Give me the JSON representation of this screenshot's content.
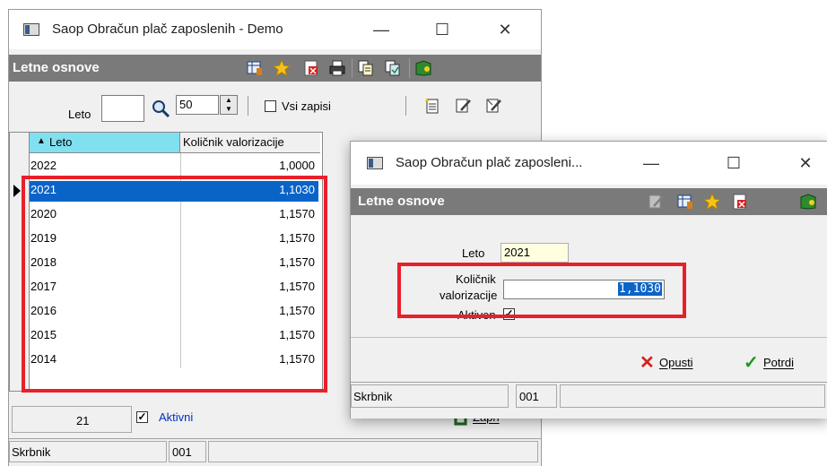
{
  "main_window": {
    "title": "Saop Obračun plač zaposlenih - Demo",
    "controls": {
      "minimize": "—",
      "maximize": "☐",
      "close": "✕"
    },
    "header_title": "Letne osnove",
    "filter": {
      "leto_label": "Leto",
      "leto_value": "",
      "count_value": "50",
      "vsi_zapisi_label": "Vsi zapisi"
    },
    "grid": {
      "sort_indicator": "▲",
      "columns": [
        "Leto",
        "Količnik valorizacije"
      ],
      "rows": [
        {
          "leto": "2022",
          "kolicnik": "1,0000"
        },
        {
          "leto": "2021",
          "kolicnik": "1,1030"
        },
        {
          "leto": "2020",
          "kolicnik": "1,1570"
        },
        {
          "leto": "2019",
          "kolicnik": "1,1570"
        },
        {
          "leto": "2018",
          "kolicnik": "1,1570"
        },
        {
          "leto": "2017",
          "kolicnik": "1,1570"
        },
        {
          "leto": "2016",
          "kolicnik": "1,1570"
        },
        {
          "leto": "2015",
          "kolicnik": "1,1570"
        },
        {
          "leto": "2014",
          "kolicnik": "1,1570"
        }
      ],
      "selected_index": 1
    },
    "footer": {
      "count": "21",
      "aktivni_label": "Aktivni",
      "zapri_label": "Zapri"
    },
    "status": {
      "user": "Skrbnik",
      "code": "001"
    }
  },
  "dialog": {
    "title": "Saop Obračun plač zaposleni...",
    "controls": {
      "minimize": "—",
      "maximize": "☐",
      "close": "✕"
    },
    "header_title": "Letne osnove",
    "leto_label": "Leto",
    "leto_value": "2021",
    "kolicnik_label_1": "Količnik",
    "kolicnik_label_2": "valorizacije",
    "kolicnik_value": "1,1030",
    "aktiven_label": "Aktiven",
    "opusti_label": "Opusti",
    "potrdi_label": "Potrdi",
    "status": {
      "user": "Skrbnik",
      "code": "001"
    }
  },
  "colors": {
    "header_bg": "#7a7a7a",
    "selection": "#0a64c8",
    "highlight_red": "#e8202a",
    "grid_header": "#80e0f0",
    "leto_field": "#ffffe0",
    "aktivni_text": "#0030c0"
  },
  "icons": [
    "app-icon",
    "grid-view-icon",
    "star-icon",
    "delete-icon",
    "print-icon",
    "copy-icon",
    "copy-alt-icon",
    "exit-icon",
    "search-icon",
    "new-icon",
    "edit-icon",
    "edit-alt-icon",
    "cancel-icon",
    "confirm-icon",
    "close-book-icon"
  ]
}
